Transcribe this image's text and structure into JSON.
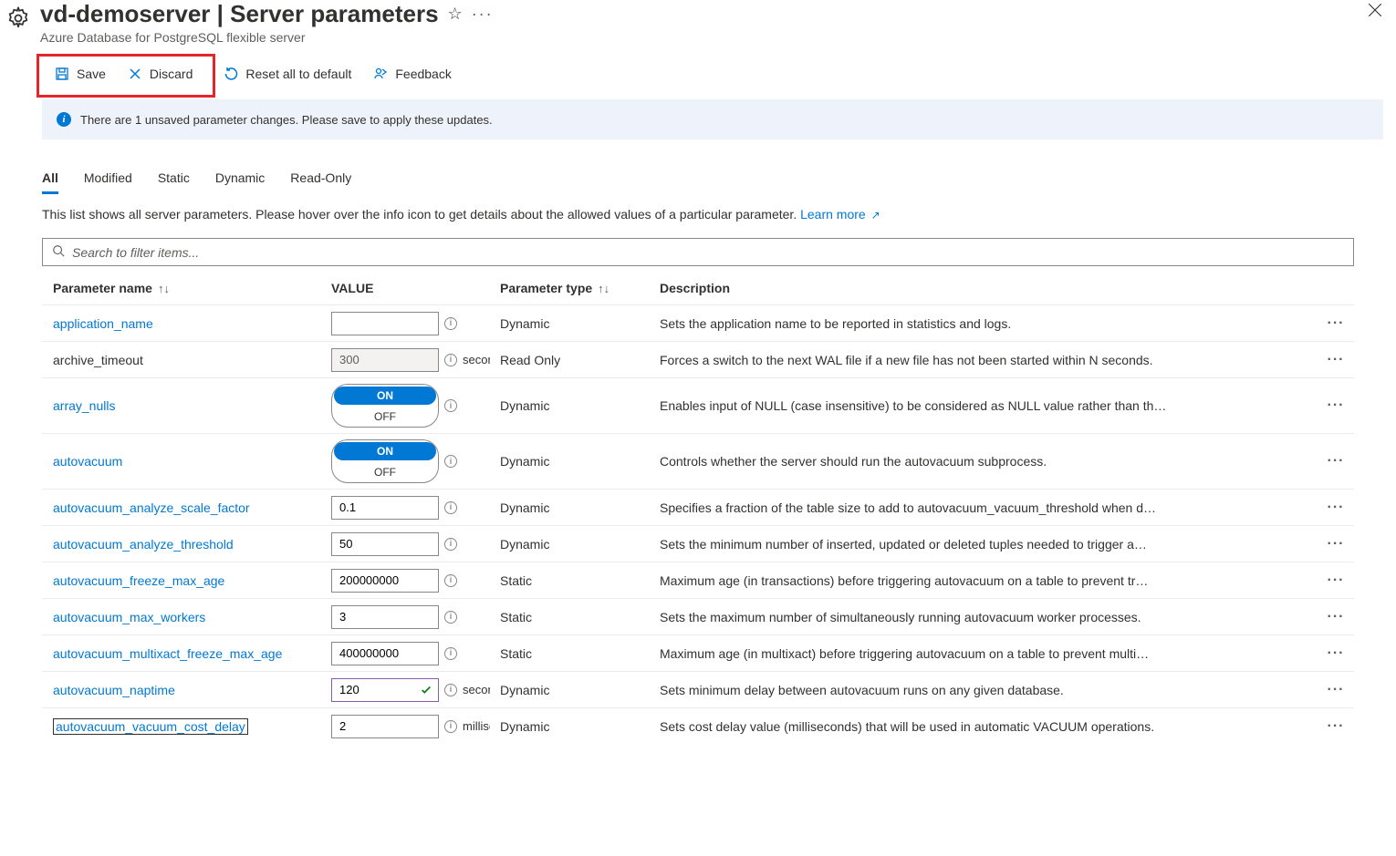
{
  "header": {
    "server_name": "vd-demoserver",
    "separator": " | ",
    "page_name": "Server parameters",
    "subtitle": "Azure Database for PostgreSQL flexible server"
  },
  "toolbar": {
    "save": "Save",
    "discard": "Discard",
    "reset": "Reset all to default",
    "feedback": "Feedback"
  },
  "banner": {
    "text": "There are 1 unsaved parameter changes.  Please save to apply these updates."
  },
  "tabs": {
    "all": "All",
    "modified": "Modified",
    "static": "Static",
    "dynamic": "Dynamic",
    "readonly": "Read-Only"
  },
  "description": {
    "text": "This list shows all server parameters. Please hover over the info icon to get details about the allowed values of a particular parameter. ",
    "learn_more": "Learn more"
  },
  "search": {
    "placeholder": "Search to filter items..."
  },
  "columns": {
    "name": "Parameter name",
    "value": "VALUE",
    "type": "Parameter type",
    "desc": "Description"
  },
  "toggle": {
    "on": "ON",
    "off": "OFF"
  },
  "rows": [
    {
      "name": "application_name",
      "link": true,
      "value": "",
      "input_type": "text",
      "type": "Dynamic",
      "desc": "Sets the application name to be reported in statistics and logs."
    },
    {
      "name": "archive_timeout",
      "link": false,
      "value": "300",
      "input_type": "readonly",
      "unit": "seconds",
      "type": "Read Only",
      "desc": "Forces a switch to the next WAL file if a new file has not been started within N seconds."
    },
    {
      "name": "array_nulls",
      "link": true,
      "input_type": "toggle",
      "type": "Dynamic",
      "desc": "Enables input of NULL (case insensitive) to be considered as NULL value rather than th…"
    },
    {
      "name": "autovacuum",
      "link": true,
      "input_type": "toggle",
      "type": "Dynamic",
      "desc": "Controls whether the server should run the autovacuum subprocess."
    },
    {
      "name": "autovacuum_analyze_scale_factor",
      "link": true,
      "value": "0.1",
      "input_type": "text",
      "type": "Dynamic",
      "desc": "Specifies a fraction of the table size to add to autovacuum_vacuum_threshold when d…"
    },
    {
      "name": "autovacuum_analyze_threshold",
      "link": true,
      "value": "50",
      "input_type": "text",
      "type": "Dynamic",
      "desc": "Sets the minimum number of inserted, updated or deleted tuples needed to trigger a…"
    },
    {
      "name": "autovacuum_freeze_max_age",
      "link": true,
      "value": "200000000",
      "input_type": "text",
      "type": "Static",
      "desc": "Maximum age (in transactions) before triggering autovacuum on a table to prevent tr…"
    },
    {
      "name": "autovacuum_max_workers",
      "link": true,
      "value": "3",
      "input_type": "text",
      "type": "Static",
      "desc": "Sets the maximum number of simultaneously running autovacuum worker processes."
    },
    {
      "name": "autovacuum_multixact_freeze_max_age",
      "link": true,
      "value": "400000000",
      "input_type": "text",
      "type": "Static",
      "desc": "Maximum age (in multixact) before triggering autovacuum on a table to prevent multi…"
    },
    {
      "name": "autovacuum_naptime",
      "link": true,
      "value": "120",
      "input_type": "dirty",
      "unit": "seconds",
      "type": "Dynamic",
      "desc": "Sets minimum delay between autovacuum runs on any given database."
    },
    {
      "name": "autovacuum_vacuum_cost_delay",
      "link": true,
      "boxed": true,
      "value": "2",
      "input_type": "text",
      "unit": "milliseconds",
      "type": "Dynamic",
      "desc": "Sets cost delay value (milliseconds) that will be used in automatic VACUUM operations."
    }
  ]
}
